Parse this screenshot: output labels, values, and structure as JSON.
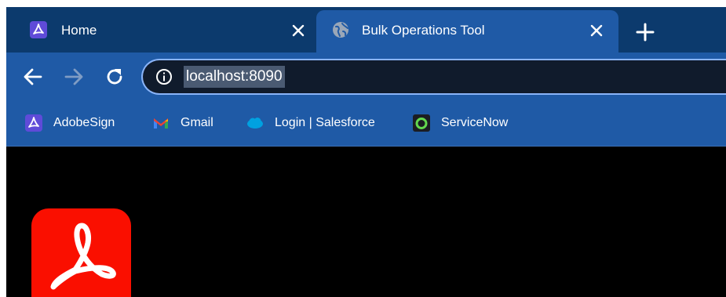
{
  "tabs": [
    {
      "title": "Home",
      "favicon": "adobe-acrobat-sign-icon",
      "active": false
    },
    {
      "title": "Bulk Operations Tool",
      "favicon": "globe-icon",
      "active": true
    }
  ],
  "toolbar": {
    "url": "localhost:8090",
    "back_icon": "arrow-left-icon",
    "forward_icon": "arrow-right-icon",
    "reload_icon": "reload-icon",
    "site_info_icon": "info-circle-icon"
  },
  "bookmarks": [
    {
      "label": "AdobeSign",
      "icon": "adobe-sign-icon"
    },
    {
      "label": "Gmail",
      "icon": "gmail-icon"
    },
    {
      "label": "Login | Salesforce",
      "icon": "salesforce-cloud-icon"
    },
    {
      "label": "ServiceNow",
      "icon": "servicenow-icon"
    }
  ],
  "page": {
    "logo": "adobe-acrobat-logo"
  },
  "colors": {
    "tabstrip_bg": "#0c3a6d",
    "toolbar_bg": "#1f5aa6",
    "omnibox_bg": "#101b2c",
    "page_bg": "#000000",
    "acrobat_red": "#fa0f00"
  }
}
